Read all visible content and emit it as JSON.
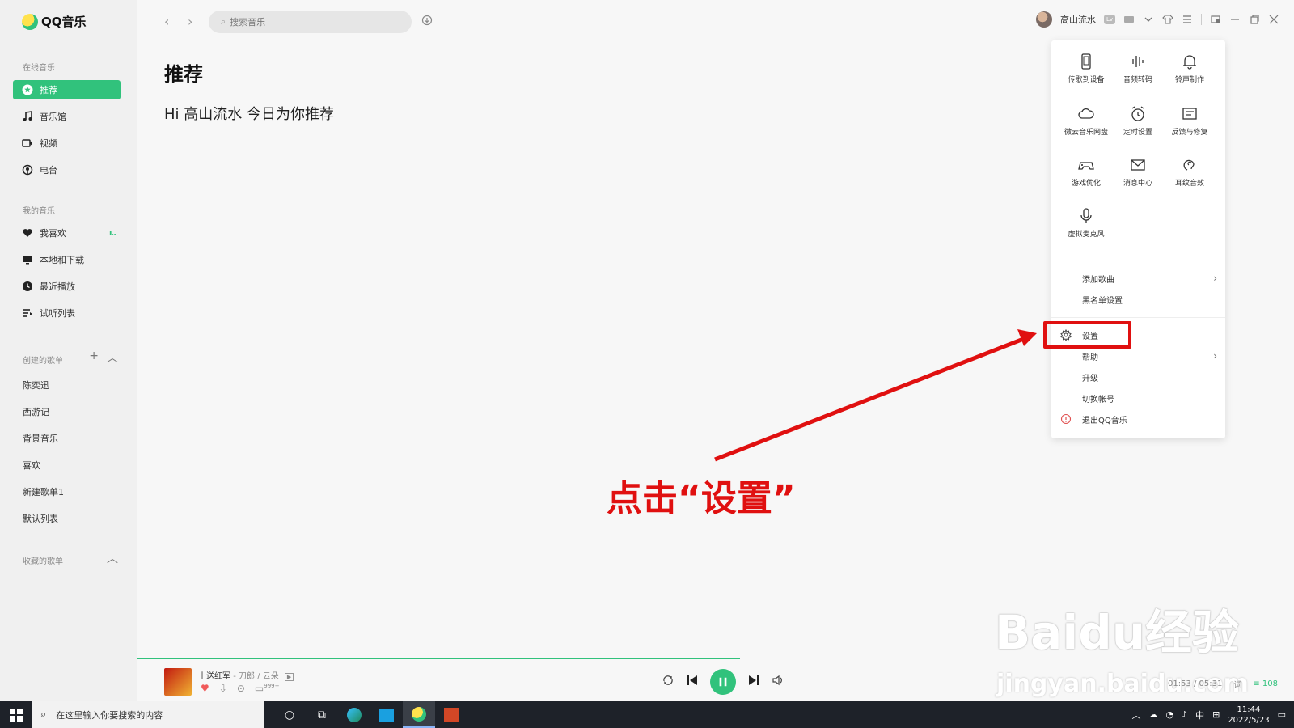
{
  "app": {
    "name": "QQ音乐"
  },
  "sidebar": {
    "online_title": "在线音乐",
    "online_items": [
      {
        "label": "推荐",
        "icon": "star-icon",
        "active": true
      },
      {
        "label": "音乐馆",
        "icon": "music-note-icon"
      },
      {
        "label": "视频",
        "icon": "video-icon"
      },
      {
        "label": "电台",
        "icon": "radio-icon"
      }
    ],
    "my_title": "我的音乐",
    "my_items": [
      {
        "label": "我喜欢",
        "icon": "heart-icon"
      },
      {
        "label": "本地和下载",
        "icon": "monitor-icon"
      },
      {
        "label": "最近播放",
        "icon": "clock-icon"
      },
      {
        "label": "试听列表",
        "icon": "list-icon"
      }
    ],
    "created_title": "创建的歌单",
    "created_playlists": [
      "陈奕迅",
      "西游记",
      "背景音乐",
      "喜欢",
      "新建歌单1",
      "默认列表"
    ],
    "collected_title": "收藏的歌单"
  },
  "topbar": {
    "search_placeholder": "搜索音乐",
    "username": "高山流水",
    "badge": "Lv"
  },
  "main": {
    "title": "推荐",
    "greeting": "Hi 高山流水 今日为你推荐"
  },
  "menu": {
    "grid": [
      {
        "label": "传歌到设备",
        "icon": "phone-icon"
      },
      {
        "label": "音频转码",
        "icon": "audio-wave-icon"
      },
      {
        "label": "铃声制作",
        "icon": "bell-icon"
      },
      {
        "label": "微云音乐网盘",
        "icon": "cloud-icon"
      },
      {
        "label": "定时设置",
        "icon": "alarm-icon"
      },
      {
        "label": "反馈与修复",
        "icon": "feedback-icon"
      },
      {
        "label": "游戏优化",
        "icon": "gamepad-icon"
      },
      {
        "label": "消息中心",
        "icon": "mail-icon"
      },
      {
        "label": "耳纹音效",
        "icon": "ear-icon"
      },
      {
        "label": "虚拟麦克风",
        "icon": "microphone-icon"
      }
    ],
    "items": [
      {
        "label": "添加歌曲",
        "has_submenu": true
      },
      {
        "label": "黑名单设置"
      },
      {
        "label": "设置",
        "icon": "gear-icon",
        "highlighted": true
      },
      {
        "label": "帮助",
        "has_submenu": true
      },
      {
        "label": "升级"
      },
      {
        "label": "切换帐号"
      },
      {
        "label": "退出QQ音乐",
        "icon": "exit-icon"
      }
    ]
  },
  "annotation": {
    "text": "点击“设置”",
    "color": "#e01010"
  },
  "watermark": {
    "brand": "Baidu经验",
    "url": "jingyan.baidu.com"
  },
  "player": {
    "song": "十送红军",
    "artist": "刀郎 / 云朵",
    "comment_count": "999+",
    "time": "01:53 / 05:31",
    "lyrics_label": "词",
    "playlist_count": "108",
    "progress": 0.52
  },
  "taskbar": {
    "search_placeholder": "在这里输入你要搜索的内容",
    "ime": "中",
    "time": "11:44",
    "date": "2022/5/23"
  },
  "colors": {
    "accent": "#31c27c",
    "annotation": "#e01010"
  }
}
